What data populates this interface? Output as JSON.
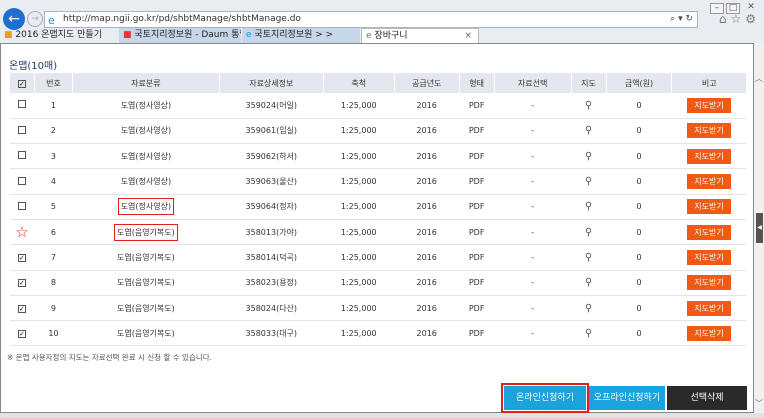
{
  "browser": {
    "url": "http://map.ngii.go.kr/pd/shbtManage/shbtManage.do",
    "tabs": [
      {
        "label": "2016 온맵지도 만들기"
      },
      {
        "label": "국토지리정보원 - Daum 통합 ..."
      },
      {
        "label": "국토지리정보원 > >"
      },
      {
        "label": "장바구니",
        "active": true
      }
    ]
  },
  "section_title": "온맵(10매)",
  "columns": [
    "번호",
    "자료분류",
    "자료상세정보",
    "축척",
    "공급년도",
    "형태",
    "자료선택",
    "지도",
    "금액(원)",
    "비고"
  ],
  "rows": [
    {
      "checked": false,
      "no": "1",
      "category": "도엽(정사영상)",
      "detail": "359024(어일)",
      "scale": "1:25,000",
      "year": "2016",
      "format": "PDF",
      "selection": "-",
      "price": "0",
      "action": "지도받기"
    },
    {
      "checked": false,
      "no": "2",
      "category": "도엽(정사영상)",
      "detail": "359061(입실)",
      "scale": "1:25,000",
      "year": "2016",
      "format": "PDF",
      "selection": "-",
      "price": "0",
      "action": "지도받기"
    },
    {
      "checked": false,
      "no": "3",
      "category": "도엽(정사영상)",
      "detail": "359062(하서)",
      "scale": "1:25,000",
      "year": "2016",
      "format": "PDF",
      "selection": "-",
      "price": "0",
      "action": "지도받기"
    },
    {
      "checked": false,
      "no": "4",
      "category": "도엽(정사영상)",
      "detail": "359063(울산)",
      "scale": "1:25,000",
      "year": "2016",
      "format": "PDF",
      "selection": "-",
      "price": "0",
      "action": "지도받기"
    },
    {
      "checked": false,
      "no": "5",
      "category": "도엽(정사영상)",
      "detail": "359064(정자)",
      "scale": "1:25,000",
      "year": "2016",
      "format": "PDF",
      "selection": "-",
      "price": "0",
      "action": "지도받기",
      "highlight": true
    },
    {
      "checked": "star",
      "no": "6",
      "category": "도엽(음영기복도)",
      "detail": "358013(가야)",
      "scale": "1:25,000",
      "year": "2016",
      "format": "PDF",
      "selection": "-",
      "price": "0",
      "action": "지도받기",
      "highlight": true
    },
    {
      "checked": true,
      "no": "7",
      "category": "도엽(음영기복도)",
      "detail": "358014(덕곡)",
      "scale": "1:25,000",
      "year": "2016",
      "format": "PDF",
      "selection": "-",
      "price": "0",
      "action": "지도받기"
    },
    {
      "checked": true,
      "no": "8",
      "category": "도엽(음영기복도)",
      "detail": "358023(용정)",
      "scale": "1:25,000",
      "year": "2016",
      "format": "PDF",
      "selection": "-",
      "price": "0",
      "action": "지도받기"
    },
    {
      "checked": true,
      "no": "9",
      "category": "도엽(음영기복도)",
      "detail": "358024(다산)",
      "scale": "1:25,000",
      "year": "2016",
      "format": "PDF",
      "selection": "-",
      "price": "0",
      "action": "지도받기"
    },
    {
      "checked": true,
      "no": "10",
      "category": "도엽(음영기복도)",
      "detail": "358033(대구)",
      "scale": "1:25,000",
      "year": "2016",
      "format": "PDF",
      "selection": "-",
      "price": "0",
      "action": "지도받기"
    }
  ],
  "note": "※ 온맵 사용자정의 지도는 자료선택 완료 시 신청 할 수 있습니다.",
  "buttons": {
    "online": "온라인신청하기",
    "offline": "오프라인신청하기",
    "delete": "선택삭제"
  },
  "colors": {
    "accent": "#1aa3dc",
    "download": "#f05a14",
    "highlight": "#e02020"
  }
}
